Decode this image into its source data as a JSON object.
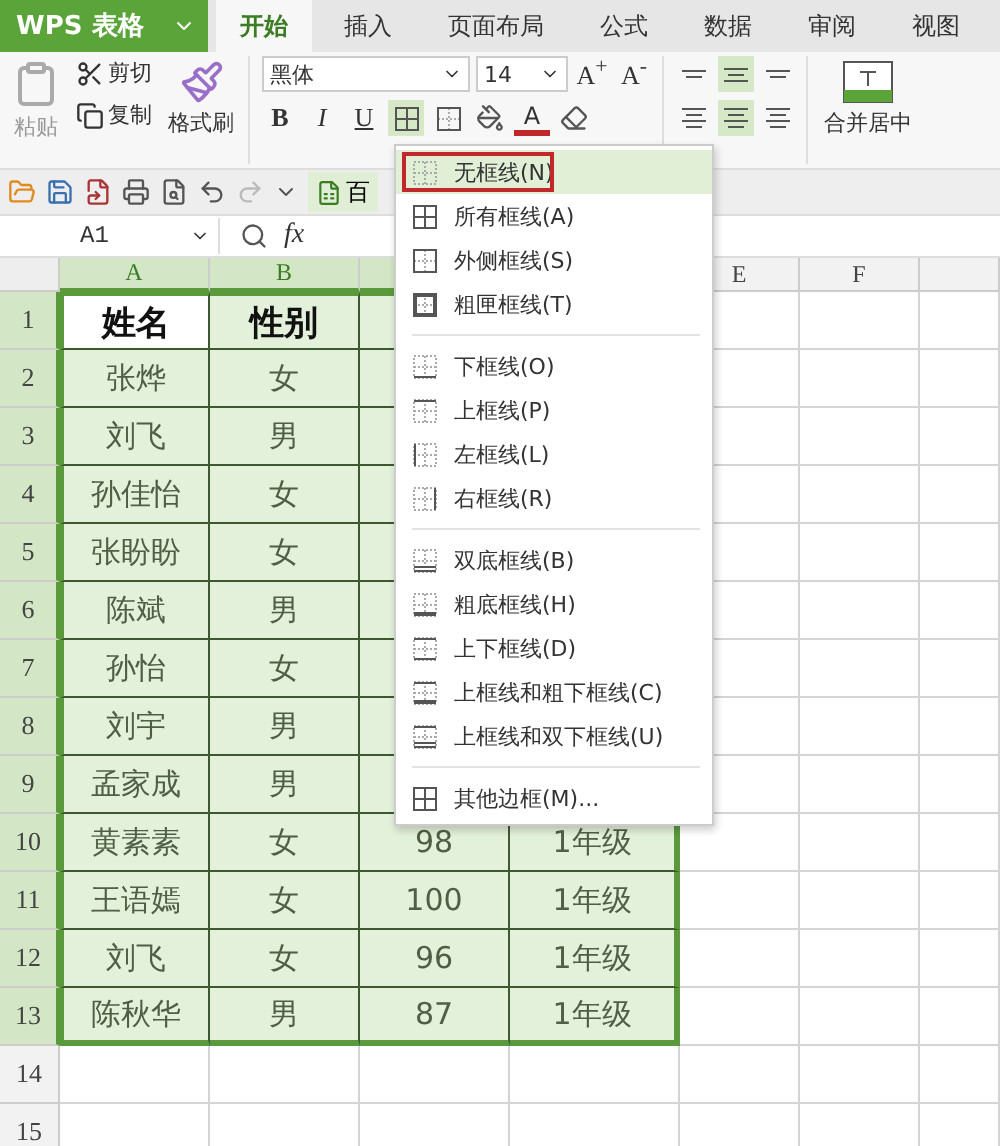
{
  "app_menu": {
    "label": "WPS 表格"
  },
  "tabs": [
    {
      "label": "开始",
      "selected": true
    },
    {
      "label": "插入",
      "selected": false
    },
    {
      "label": "页面布局",
      "selected": false
    },
    {
      "label": "公式",
      "selected": false
    },
    {
      "label": "数据",
      "selected": false
    },
    {
      "label": "审阅",
      "selected": false
    },
    {
      "label": "视图",
      "selected": false
    }
  ],
  "ribbon": {
    "paste": {
      "label": "粘贴",
      "disabled": true
    },
    "cut": "剪切",
    "copy": "复制",
    "format_painter": "格式刷",
    "font": "黑体",
    "font_size": "14",
    "grow_font": "A$^{+}$",
    "shrink_font": "A$^{-}$",
    "bold": "B",
    "italic": "I",
    "underline": "U",
    "font_color": "A",
    "merge": "合并居中"
  },
  "quick_toolbar": {
    "doc_tab": "百"
  },
  "formula_bar": {
    "cell_ref": "A1",
    "fx": "fx"
  },
  "sheet": {
    "columns": [
      {
        "label": "A",
        "selected": true
      },
      {
        "label": "B",
        "selected": true
      },
      {
        "selected": true
      },
      {
        "selected": true
      },
      {
        "label": "E",
        "selected": false
      },
      {
        "label": "F",
        "selected": false
      }
    ],
    "rows": [
      {
        "number": "1",
        "selected": true,
        "header": true,
        "cells": [
          "姓名",
          "性别"
        ]
      },
      {
        "number": "2",
        "selected": true,
        "header": false,
        "cells": [
          "张烨",
          "女"
        ]
      },
      {
        "number": "3",
        "selected": true,
        "header": false,
        "cells": [
          "刘飞",
          "男"
        ]
      },
      {
        "number": "4",
        "selected": true,
        "header": false,
        "cells": [
          "孙佳怡",
          "女"
        ]
      },
      {
        "number": "5",
        "selected": true,
        "header": false,
        "cells": [
          "张盼盼",
          "女"
        ]
      },
      {
        "number": "6",
        "selected": true,
        "header": false,
        "cells": [
          "陈斌",
          "男"
        ]
      },
      {
        "number": "7",
        "selected": true,
        "header": false,
        "cells": [
          "孙怡",
          "女"
        ]
      },
      {
        "number": "8",
        "selected": true,
        "header": false,
        "cells": [
          "刘宇",
          "男"
        ]
      },
      {
        "number": "9",
        "selected": true,
        "header": false,
        "cells": [
          "孟家成",
          "男"
        ]
      },
      {
        "number": "10",
        "selected": true,
        "header": false,
        "cells": [
          "黄素素",
          "女",
          "98",
          "1年级"
        ]
      },
      {
        "number": "11",
        "selected": true,
        "header": false,
        "cells": [
          "王语嫣",
          "女",
          "100",
          "1年级"
        ]
      },
      {
        "number": "12",
        "selected": true,
        "header": false,
        "cells": [
          "刘飞",
          "女",
          "96",
          "1年级"
        ]
      },
      {
        "number": "13",
        "selected": true,
        "header": false,
        "cells": [
          "陈秋华",
          "男",
          "87",
          "1年级"
        ]
      },
      {
        "number": "14",
        "selected": false
      },
      {
        "number": "15",
        "selected": false
      }
    ]
  },
  "border_menu": {
    "groups": [
      [
        {
          "label": "无框线(N)",
          "kind": "none",
          "selected": true
        },
        {
          "label": "所有框线(A)",
          "kind": "all",
          "selected": false
        },
        {
          "label": "外侧框线(S)",
          "kind": "outside",
          "selected": false
        },
        {
          "label": "粗匣框线(T)",
          "kind": "thick_box",
          "selected": false
        }
      ],
      [
        {
          "label": "下框线(O)",
          "kind": "bottom",
          "selected": false
        },
        {
          "label": "上框线(P)",
          "kind": "top",
          "selected": false
        },
        {
          "label": "左框线(L)",
          "kind": "left",
          "selected": false
        },
        {
          "label": "右框线(R)",
          "kind": "right",
          "selected": false
        }
      ],
      [
        {
          "label": "双底框线(B)",
          "kind": "double_bottom",
          "selected": false
        },
        {
          "label": "粗底框线(H)",
          "kind": "thick_bottom",
          "selected": false
        },
        {
          "label": "上下框线(D)",
          "kind": "top_bottom",
          "selected": false
        },
        {
          "label": "上框线和粗下框线(C)",
          "kind": "top_thick_bottom",
          "selected": false
        },
        {
          "label": "上框线和双下框线(U)",
          "kind": "top_double_bottom",
          "selected": false
        }
      ],
      [
        {
          "label": "其他边框(M)...",
          "kind": "more",
          "selected": false
        }
      ]
    ]
  }
}
